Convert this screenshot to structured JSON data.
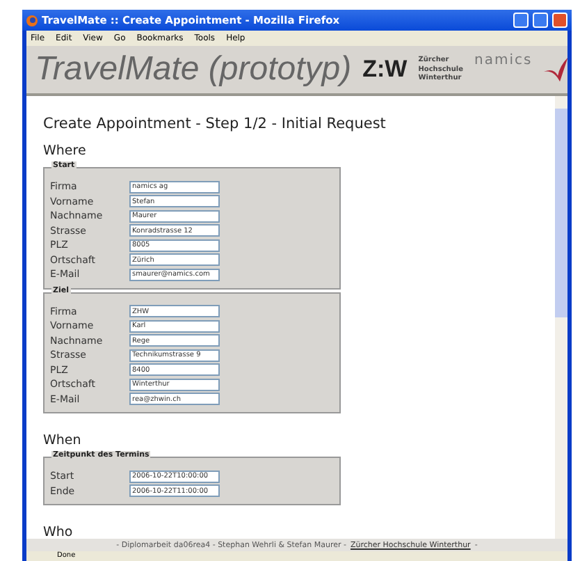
{
  "window": {
    "title": "TravelMate :: Create Appointment - Mozilla Firefox"
  },
  "menu": [
    "File",
    "Edit",
    "View",
    "Go",
    "Bookmarks",
    "Tools",
    "Help"
  ],
  "banner": {
    "title": "TravelMate (prototyp)",
    "school_logo": "Z:W",
    "school_name": [
      "Zürcher",
      "Hochschule",
      "Winterthur"
    ],
    "partner": "namics"
  },
  "heading": "Create Appointment - Step 1/2 - Initial Request",
  "sections": [
    {
      "title": "Where",
      "groups": [
        {
          "legend": "Start",
          "fields": [
            {
              "label": "Firma",
              "value": "namics ag"
            },
            {
              "label": "Vorname",
              "value": "Stefan"
            },
            {
              "label": "Nachname",
              "value": "Maurer"
            },
            {
              "label": "Strasse",
              "value": "Konradstrasse 12"
            },
            {
              "label": "PLZ",
              "value": "8005"
            },
            {
              "label": "Ortschaft",
              "value": "Zürich"
            },
            {
              "label": "E-Mail",
              "value": "smaurer@namics.com"
            }
          ]
        },
        {
          "legend": "Ziel",
          "fields": [
            {
              "label": "Firma",
              "value": "ZHW"
            },
            {
              "label": "Vorname",
              "value": "Karl"
            },
            {
              "label": "Nachname",
              "value": "Rege"
            },
            {
              "label": "Strasse",
              "value": "Technikumstrasse 9"
            },
            {
              "label": "PLZ",
              "value": "8400"
            },
            {
              "label": "Ortschaft",
              "value": "Winterthur"
            },
            {
              "label": "E-Mail",
              "value": "rea@zhwin.ch"
            }
          ]
        }
      ]
    },
    {
      "title": "When",
      "groups": [
        {
          "legend": "Zeitpunkt des Termins",
          "fields": [
            {
              "label": "Start",
              "value": "2006-10-22T10:00:00"
            },
            {
              "label": "Ende",
              "value": "2006-10-22T11:00:00"
            }
          ]
        }
      ]
    },
    {
      "title": "Who"
    }
  ],
  "footer": {
    "text": "- Diplomarbeit da06rea4 - Stephan Wehrli & Stefan Maurer -",
    "link": "Zürcher Hochschule Winterthur",
    "end": "-"
  },
  "status_bar": {
    "text": "Done"
  }
}
